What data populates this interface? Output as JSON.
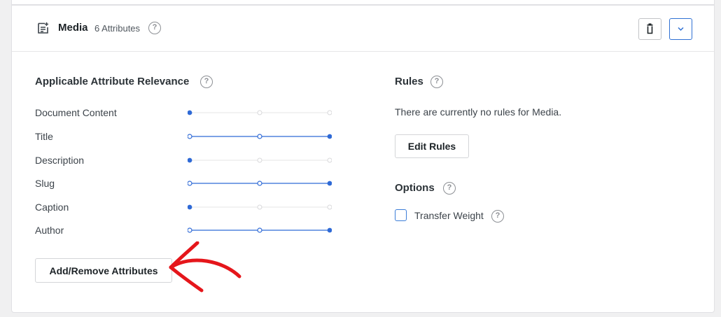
{
  "header": {
    "title": "Media",
    "attribute_count": "6 Attributes",
    "help_glyph": "?",
    "icon": "document-settings-icon"
  },
  "relevance": {
    "title": "Applicable Attribute Relevance",
    "attributes": [
      {
        "label": "Document Content",
        "level": 1
      },
      {
        "label": "Title",
        "level": 3
      },
      {
        "label": "Description",
        "level": 1
      },
      {
        "label": "Slug",
        "level": 3
      },
      {
        "label": "Caption",
        "level": 1
      },
      {
        "label": "Author",
        "level": 3
      }
    ],
    "levels_total": 3,
    "add_remove_label": "Add/Remove Attributes"
  },
  "rules": {
    "title": "Rules",
    "empty_text": "There are currently no rules for Media.",
    "edit_label": "Edit Rules"
  },
  "options": {
    "title": "Options",
    "transfer_weight_label": "Transfer Weight",
    "transfer_weight_checked": false
  },
  "colors": {
    "accent": "#2f6ad6",
    "annotation_arrow": "#e5161b"
  }
}
